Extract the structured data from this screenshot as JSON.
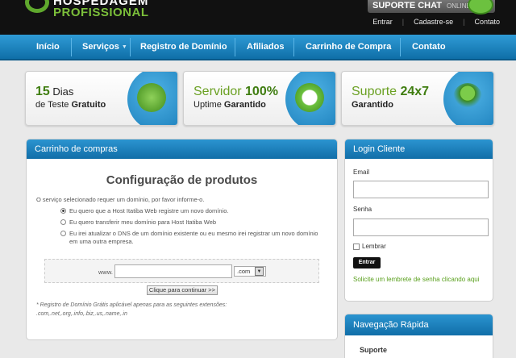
{
  "brand": {
    "line1": "HOSPEDAGEM",
    "line2": "PROFISSIONAL",
    "accent": "#5fa82d"
  },
  "chat": {
    "label": "SUPORTE CHAT",
    "status": "ONLINE"
  },
  "top_links": [
    "Entrar",
    "Cadastre-se",
    "Contato"
  ],
  "nav": {
    "items": [
      "Início",
      "Serviços",
      "Registro de Domínio",
      "Afiliados",
      "Carrinho de Compra",
      "Contato"
    ],
    "color": "#1a86c4"
  },
  "promos": [
    {
      "strong": "15",
      "text": " Dias",
      "line2": "de Teste ",
      "line2_bold": "Gratuito",
      "icon": "money-bag-icon"
    },
    {
      "strong": "100%",
      "text": "Servidor ",
      "line2": "Uptime ",
      "line2_bold": "Garantido",
      "icon": "clock-icon"
    },
    {
      "strong": "24x7",
      "text": "Suporte ",
      "line2": "",
      "line2_bold": "Garantido",
      "icon": "user-support-icon"
    }
  ],
  "cart": {
    "header": "Carrinho de compras",
    "title": "Configuração de produtos",
    "notice": "O serviço selecionado requer um domínio, por favor informe-o.",
    "options": [
      "Eu quero que a Host Itatiba Web registre um novo domínio.",
      "Eu quero transferir meu domínio para Host Itatiba Web",
      "Eu irei atualizar o DNS de um domínio existente ou eu mesmo irei registrar um novo domínio em uma outra empresa."
    ],
    "www_label": "www.",
    "domain_value": "",
    "tld_value": ".com",
    "continue_label": "Clique para continuar >>",
    "footnote_line1": "* Registro de Domínio Grátis aplicável apenas para as seguintes extensões:",
    "footnote_line2": ".com,.net,.org,.info,.biz,.us,.name,.in"
  },
  "login": {
    "header": "Login Cliente",
    "email_label": "Email",
    "password_label": "Senha",
    "remember_label": "Lembrar",
    "enter_label": "Entrar",
    "reminder": "Solicite um lembrete de senha clicando aqui"
  },
  "quick_nav": {
    "header": "Navegação Rápida",
    "first_item": "Suporte"
  }
}
